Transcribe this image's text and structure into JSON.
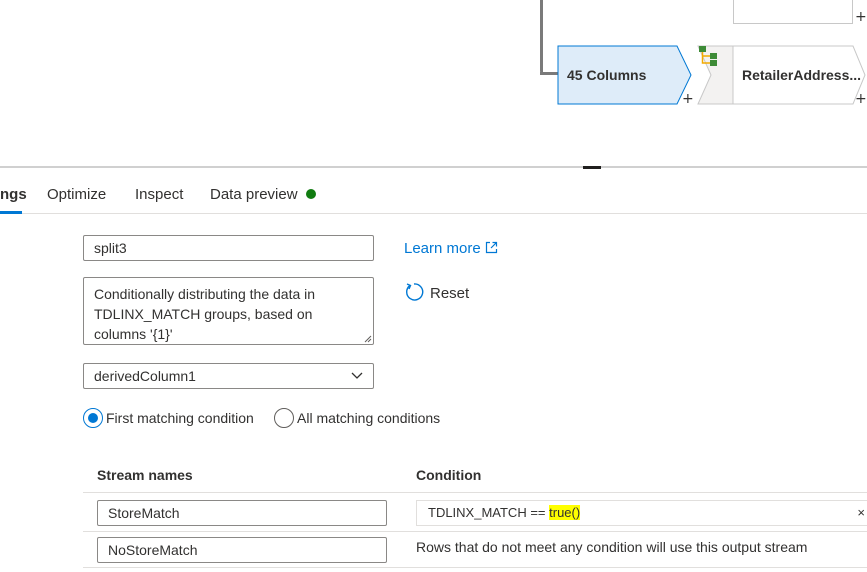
{
  "canvas": {
    "nodes": [
      {
        "label": "45 Columns",
        "selected": true
      },
      {
        "label": "RetailerAddress...",
        "icon": "conditional-split-icon"
      }
    ],
    "add_symbol": "+"
  },
  "tabs": [
    {
      "label": "ngs",
      "active": true
    },
    {
      "label": "Optimize"
    },
    {
      "label": "Inspect"
    },
    {
      "label": "Data preview",
      "status_color": "#107c10"
    }
  ],
  "form": {
    "stream_name_value": "split3",
    "description_value": "Conditionally distributing the data in TDLINX_MATCH groups, based on columns '{1}'",
    "incoming_stream_value": "derivedColumn1",
    "learn_more_label": "Learn more",
    "reset_label": "Reset",
    "split_on": {
      "options": [
        "First matching condition",
        "All matching conditions"
      ],
      "selected": "First matching condition"
    }
  },
  "table": {
    "headers": {
      "stream_names": "Stream names",
      "condition": "Condition"
    },
    "rows": [
      {
        "stream_name": "StoreMatch",
        "condition_prefix": "TDLINX_MATCH == ",
        "condition_highlight": "true()"
      },
      {
        "stream_name": "NoStoreMatch",
        "condition_text": "Rows that do not meet any condition will use this output stream"
      }
    ],
    "clear_symbol": "×"
  },
  "colors": {
    "accent": "#0078d4",
    "selected_node_fill": "#deecf9",
    "highlight": "#ffff00",
    "status_green": "#107c10"
  }
}
